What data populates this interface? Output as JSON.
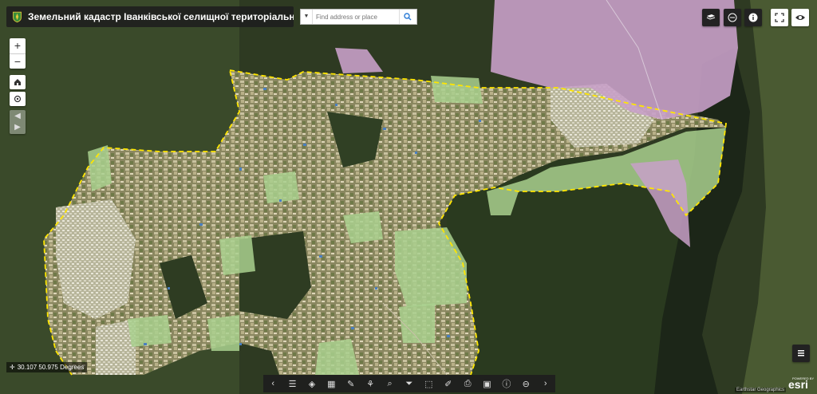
{
  "header": {
    "title": "Земельний кадастр Іванківської селищної територіальної громади"
  },
  "search": {
    "placeholder": "Find address or place",
    "dropdown_icon": "caret-down-icon",
    "go_icon": "search-icon"
  },
  "map_controls": {
    "zoom_in": "+",
    "zoom_out": "−"
  },
  "coordinates": {
    "text": "30.107 50.975 Degrees"
  },
  "attribution": {
    "text": "Earthstar Geographics",
    "powered_by": "POWERED BY",
    "brand": "esri"
  },
  "colors": {
    "forest": "#2c3c20",
    "parcel_green": "#a9d08e",
    "restricted_pink": "#c8a0c8",
    "boundary": "#ffe600",
    "toolbar_bg": "#1e1e1e"
  }
}
